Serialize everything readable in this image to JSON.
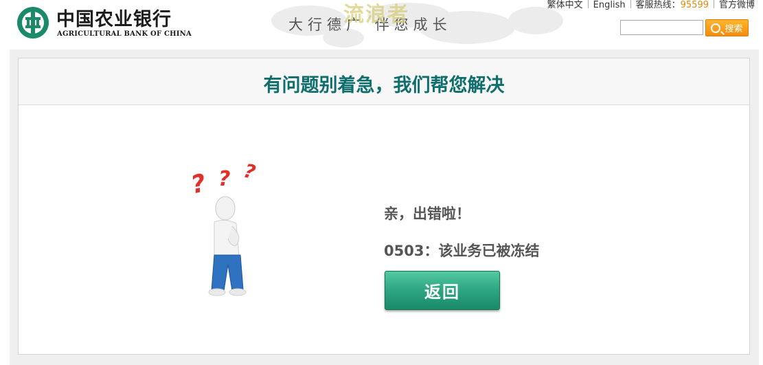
{
  "header": {
    "logo_cn": "中国农业银行",
    "logo_en": "AGRICULTURAL BANK OF CHINA",
    "slogan_left": "大行德广",
    "slogan_right": "伴您成长",
    "watermark": "流浪者",
    "links": {
      "traditional": "繁体中文",
      "english": "English",
      "hotline_label": "客服热线：",
      "hotline_number": "95599",
      "weibo": "官方微博"
    },
    "search": {
      "value": "",
      "placeholder": "",
      "button_label": "搜索"
    }
  },
  "main": {
    "title": "有问题别着急，我们帮您解决",
    "error_heading": "亲，出错啦！",
    "error_message": "0503：该业务已被冻结",
    "back_button": "返回"
  },
  "colors": {
    "brand_teal": "#0e6e6e",
    "logo_green": "#1a8a68",
    "accent_orange": "#f48c0a",
    "question_red": "#e0302a"
  },
  "icons": [
    "abc-logo-icon",
    "search-icon",
    "confused-figure-icon"
  ]
}
